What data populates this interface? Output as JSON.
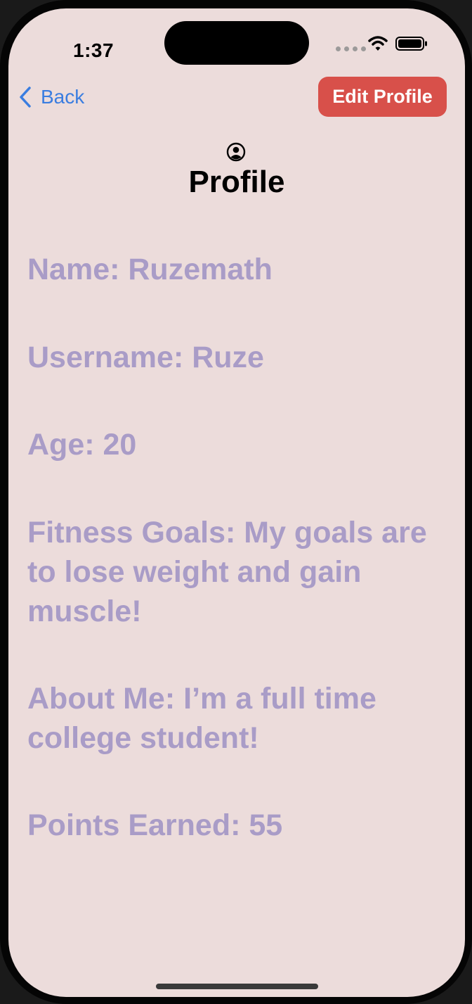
{
  "status_bar": {
    "time": "1:37"
  },
  "nav": {
    "back_label": "Back",
    "edit_label": "Edit Profile"
  },
  "header": {
    "icon": "person-circle-icon",
    "title": "Profile"
  },
  "profile": {
    "name": "Name: Ruzemath",
    "username": "Username: Ruze",
    "age": "Age: 20",
    "fitness_goals": "Fitness Goals: My goals are to lose weight and gain muscle!",
    "about_me": "About Me: I’m a full time college student!",
    "points": "Points Earned: 55"
  },
  "colors": {
    "background": "#ecdcdb",
    "accent_button": "#d8504a",
    "link": "#3a7de0",
    "field_text": "#a99cc7"
  }
}
